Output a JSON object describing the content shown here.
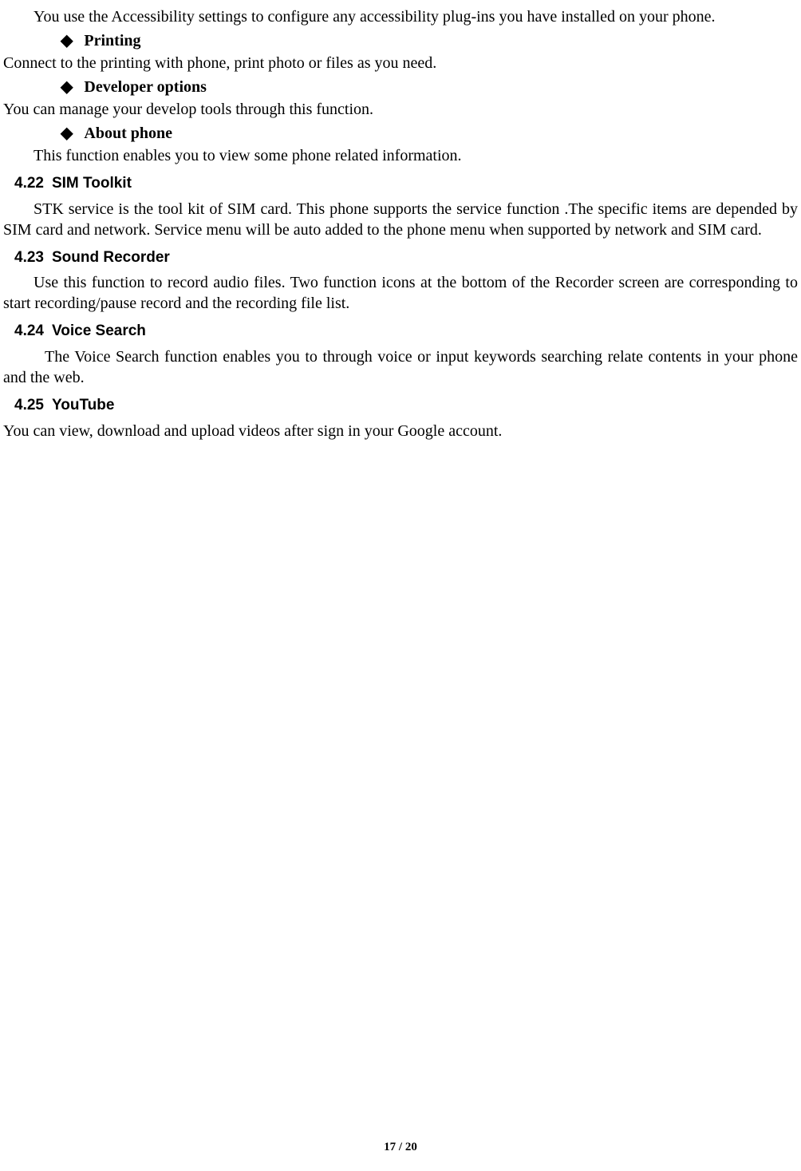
{
  "intro_para": "You use the Accessibility settings to configure any accessibility plug-ins you have installed on your phone.",
  "bullets": {
    "printing": {
      "label": "Printing",
      "desc": "Connect to the printing with phone, print photo or files as you need."
    },
    "developer": {
      "label": "Developer options",
      "desc": "You can manage your develop tools through this function."
    },
    "about": {
      "label": "About phone",
      "desc": "This function enables you to view some phone related information."
    }
  },
  "sections": {
    "sim": {
      "num": "4.22",
      "title": "SIM Toolkit",
      "body": "STK service is the tool kit of SIM card. This phone supports the service function .The specific items are depended by SIM card and network. Service menu will be auto added to the phone menu when supported by network and SIM card."
    },
    "sound": {
      "num": "4.23",
      "title": "Sound Recorder",
      "body": "Use this function to record audio files. Two function icons at the bottom of the Recorder screen are corresponding to start recording/pause record and the recording file list."
    },
    "voice": {
      "num": "4.24",
      "title": "Voice Search",
      "body": "The Voice Search function enables you to through voice or input keywords searching relate contents in your phone and the web."
    },
    "youtube": {
      "num": "4.25",
      "title": "YouTube",
      "body": "You can view, download and upload videos after sign in your Google account."
    }
  },
  "footer": {
    "page": "17",
    "sep": " / ",
    "total": "20"
  }
}
